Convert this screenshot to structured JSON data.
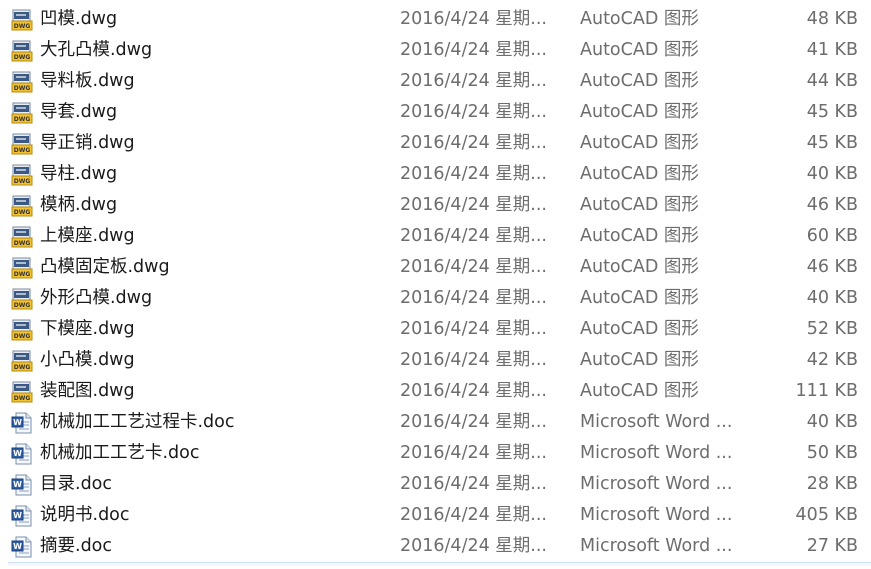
{
  "files": [
    {
      "name": "凹模.dwg",
      "date": "2016/4/24 星期...",
      "type": "AutoCAD 图形",
      "size": "48 KB",
      "icon": "dwg-file-icon"
    },
    {
      "name": "大孔凸模.dwg",
      "date": "2016/4/24 星期...",
      "type": "AutoCAD 图形",
      "size": "41 KB",
      "icon": "dwg-file-icon"
    },
    {
      "name": "导料板.dwg",
      "date": "2016/4/24 星期...",
      "type": "AutoCAD 图形",
      "size": "44 KB",
      "icon": "dwg-file-icon"
    },
    {
      "name": "导套.dwg",
      "date": "2016/4/24 星期...",
      "type": "AutoCAD 图形",
      "size": "45 KB",
      "icon": "dwg-file-icon"
    },
    {
      "name": "导正销.dwg",
      "date": "2016/4/24 星期...",
      "type": "AutoCAD 图形",
      "size": "45 KB",
      "icon": "dwg-file-icon"
    },
    {
      "name": "导柱.dwg",
      "date": "2016/4/24 星期...",
      "type": "AutoCAD 图形",
      "size": "40 KB",
      "icon": "dwg-file-icon"
    },
    {
      "name": "模柄.dwg",
      "date": "2016/4/24 星期...",
      "type": "AutoCAD 图形",
      "size": "46 KB",
      "icon": "dwg-file-icon"
    },
    {
      "name": "上模座.dwg",
      "date": "2016/4/24 星期...",
      "type": "AutoCAD 图形",
      "size": "60 KB",
      "icon": "dwg-file-icon"
    },
    {
      "name": "凸模固定板.dwg",
      "date": "2016/4/24 星期...",
      "type": "AutoCAD 图形",
      "size": "46 KB",
      "icon": "dwg-file-icon"
    },
    {
      "name": "外形凸模.dwg",
      "date": "2016/4/24 星期...",
      "type": "AutoCAD 图形",
      "size": "40 KB",
      "icon": "dwg-file-icon"
    },
    {
      "name": "下模座.dwg",
      "date": "2016/4/24 星期...",
      "type": "AutoCAD 图形",
      "size": "52 KB",
      "icon": "dwg-file-icon"
    },
    {
      "name": "小凸模.dwg",
      "date": "2016/4/24 星期...",
      "type": "AutoCAD 图形",
      "size": "42 KB",
      "icon": "dwg-file-icon"
    },
    {
      "name": "装配图.dwg",
      "date": "2016/4/24 星期...",
      "type": "AutoCAD 图形",
      "size": "111 KB",
      "icon": "dwg-file-icon"
    },
    {
      "name": "机械加工工艺过程卡.doc",
      "date": "2016/4/24 星期...",
      "type": "Microsoft Word ...",
      "size": "40 KB",
      "icon": "word-doc-icon"
    },
    {
      "name": "机械加工工艺卡.doc",
      "date": "2016/4/24 星期...",
      "type": "Microsoft Word ...",
      "size": "50 KB",
      "icon": "word-doc-icon"
    },
    {
      "name": "目录.doc",
      "date": "2016/4/24 星期...",
      "type": "Microsoft Word ...",
      "size": "28 KB",
      "icon": "word-doc-icon"
    },
    {
      "name": "说明书.doc",
      "date": "2016/4/24 星期...",
      "type": "Microsoft Word ...",
      "size": "405 KB",
      "icon": "word-doc-icon"
    },
    {
      "name": "摘要.doc",
      "date": "2016/4/24 星期...",
      "type": "Microsoft Word ...",
      "size": "27 KB",
      "icon": "word-doc-icon"
    }
  ]
}
